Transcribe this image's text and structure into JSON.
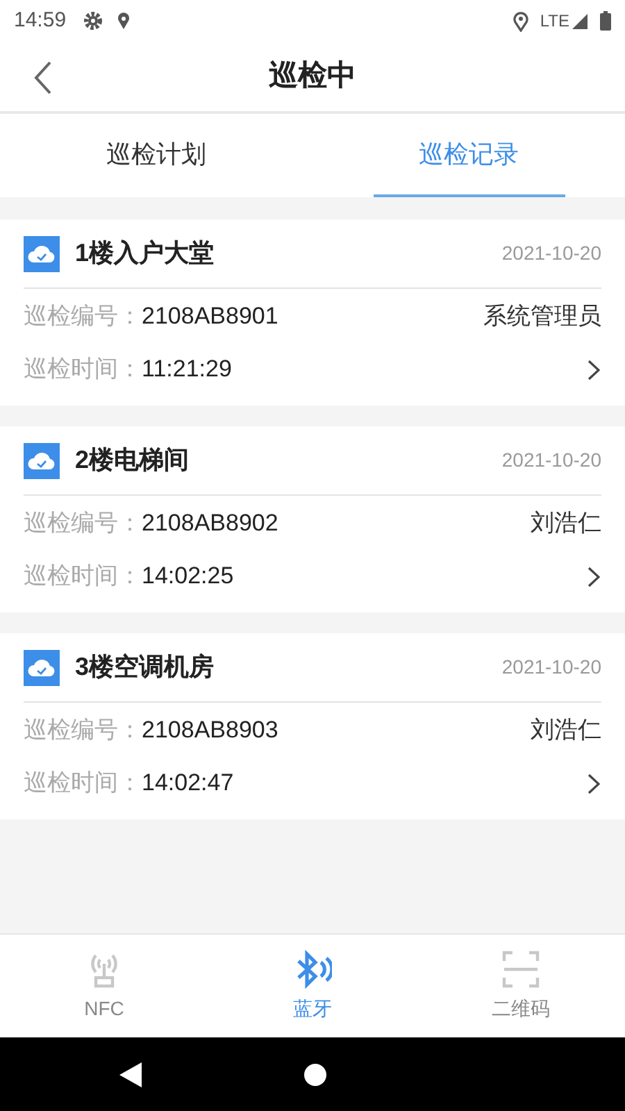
{
  "status_bar": {
    "time": "14:59",
    "network": "LTE"
  },
  "header": {
    "title": "巡检中"
  },
  "tabs": [
    {
      "label": "巡检计划",
      "selected": false
    },
    {
      "label": "巡检记录",
      "selected": true
    }
  ],
  "records": [
    {
      "title": "1楼入户大堂",
      "date": "2021-10-20",
      "number_label": "巡检编号：",
      "number": "2108AB8901",
      "person": "系统管理员",
      "time_label": "巡检时间：",
      "time": "11:21:29"
    },
    {
      "title": "2楼电梯间",
      "date": "2021-10-20",
      "number_label": "巡检编号：",
      "number": "2108AB8902",
      "person": "刘浩仁",
      "time_label": "巡检时间：",
      "time": "14:02:25"
    },
    {
      "title": "3楼空调机房",
      "date": "2021-10-20",
      "number_label": "巡检编号：",
      "number": "2108AB8903",
      "person": "刘浩仁",
      "time_label": "巡检时间：",
      "time": "14:02:47"
    }
  ],
  "bottom_nav": [
    {
      "label": "NFC",
      "kind": "nfc",
      "selected": false
    },
    {
      "label": "蓝牙",
      "kind": "bluetooth",
      "selected": true
    },
    {
      "label": "二维码",
      "kind": "qr",
      "selected": false
    }
  ]
}
